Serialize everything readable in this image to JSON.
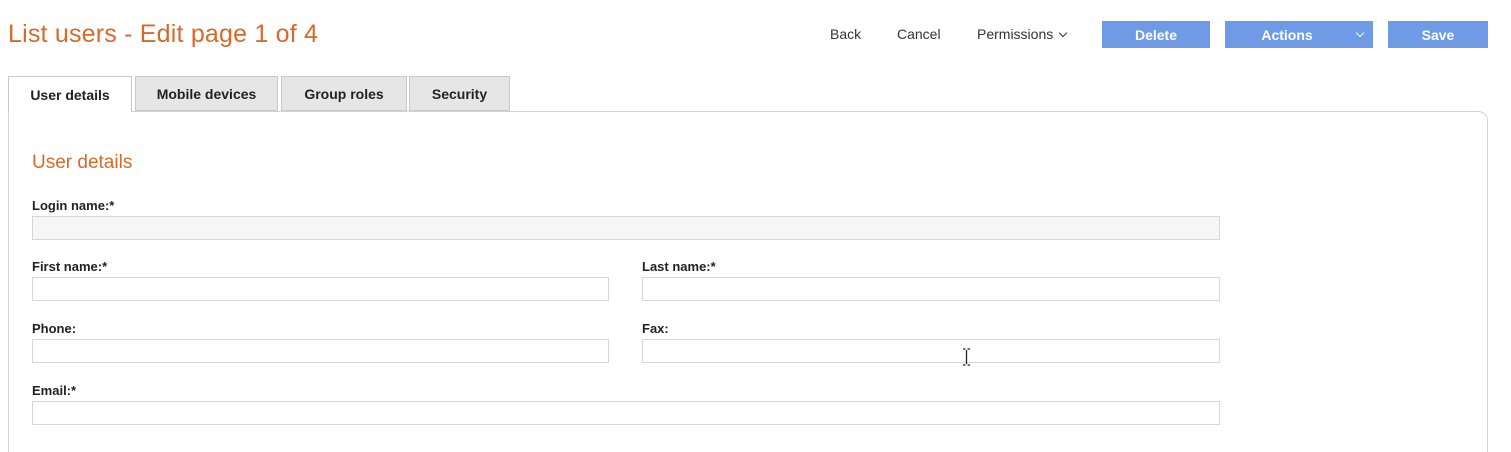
{
  "header": {
    "title": "List users - Edit page 1 of 4"
  },
  "toolbar": {
    "back_label": "Back",
    "cancel_label": "Cancel",
    "permissions_label": "Permissions",
    "delete_label": "Delete",
    "actions_label": "Actions",
    "save_label": "Save"
  },
  "tabs": [
    {
      "label": "User details",
      "active": true
    },
    {
      "label": "Mobile devices",
      "active": false
    },
    {
      "label": "Group roles",
      "active": false
    },
    {
      "label": "Security",
      "active": false
    }
  ],
  "section": {
    "title": "User details"
  },
  "fields": {
    "login_name": {
      "label": "Login name:*",
      "value": ""
    },
    "first_name": {
      "label": "First name:*",
      "value": ""
    },
    "last_name": {
      "label": "Last name:*",
      "value": ""
    },
    "phone": {
      "label": "Phone:",
      "value": ""
    },
    "fax": {
      "label": "Fax:",
      "value": ""
    },
    "email": {
      "label": "Email:*",
      "value": ""
    }
  },
  "colors": {
    "accent": "#d8692a",
    "button": "#6f9be6"
  }
}
